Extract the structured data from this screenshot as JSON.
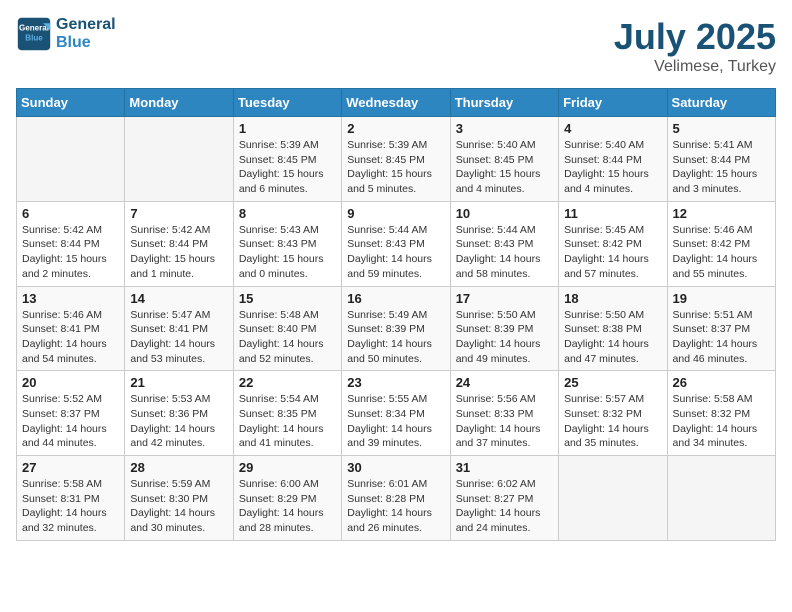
{
  "logo": {
    "line1": "General",
    "line2": "Blue"
  },
  "title": "July 2025",
  "subtitle": "Velimese, Turkey",
  "days_of_week": [
    "Sunday",
    "Monday",
    "Tuesday",
    "Wednesday",
    "Thursday",
    "Friday",
    "Saturday"
  ],
  "weeks": [
    [
      {
        "day": "",
        "info": ""
      },
      {
        "day": "",
        "info": ""
      },
      {
        "day": "1",
        "info": "Sunrise: 5:39 AM\nSunset: 8:45 PM\nDaylight: 15 hours\nand 6 minutes."
      },
      {
        "day": "2",
        "info": "Sunrise: 5:39 AM\nSunset: 8:45 PM\nDaylight: 15 hours\nand 5 minutes."
      },
      {
        "day": "3",
        "info": "Sunrise: 5:40 AM\nSunset: 8:45 PM\nDaylight: 15 hours\nand 4 minutes."
      },
      {
        "day": "4",
        "info": "Sunrise: 5:40 AM\nSunset: 8:44 PM\nDaylight: 15 hours\nand 4 minutes."
      },
      {
        "day": "5",
        "info": "Sunrise: 5:41 AM\nSunset: 8:44 PM\nDaylight: 15 hours\nand 3 minutes."
      }
    ],
    [
      {
        "day": "6",
        "info": "Sunrise: 5:42 AM\nSunset: 8:44 PM\nDaylight: 15 hours\nand 2 minutes."
      },
      {
        "day": "7",
        "info": "Sunrise: 5:42 AM\nSunset: 8:44 PM\nDaylight: 15 hours\nand 1 minute."
      },
      {
        "day": "8",
        "info": "Sunrise: 5:43 AM\nSunset: 8:43 PM\nDaylight: 15 hours\nand 0 minutes."
      },
      {
        "day": "9",
        "info": "Sunrise: 5:44 AM\nSunset: 8:43 PM\nDaylight: 14 hours\nand 59 minutes."
      },
      {
        "day": "10",
        "info": "Sunrise: 5:44 AM\nSunset: 8:43 PM\nDaylight: 14 hours\nand 58 minutes."
      },
      {
        "day": "11",
        "info": "Sunrise: 5:45 AM\nSunset: 8:42 PM\nDaylight: 14 hours\nand 57 minutes."
      },
      {
        "day": "12",
        "info": "Sunrise: 5:46 AM\nSunset: 8:42 PM\nDaylight: 14 hours\nand 55 minutes."
      }
    ],
    [
      {
        "day": "13",
        "info": "Sunrise: 5:46 AM\nSunset: 8:41 PM\nDaylight: 14 hours\nand 54 minutes."
      },
      {
        "day": "14",
        "info": "Sunrise: 5:47 AM\nSunset: 8:41 PM\nDaylight: 14 hours\nand 53 minutes."
      },
      {
        "day": "15",
        "info": "Sunrise: 5:48 AM\nSunset: 8:40 PM\nDaylight: 14 hours\nand 52 minutes."
      },
      {
        "day": "16",
        "info": "Sunrise: 5:49 AM\nSunset: 8:39 PM\nDaylight: 14 hours\nand 50 minutes."
      },
      {
        "day": "17",
        "info": "Sunrise: 5:50 AM\nSunset: 8:39 PM\nDaylight: 14 hours\nand 49 minutes."
      },
      {
        "day": "18",
        "info": "Sunrise: 5:50 AM\nSunset: 8:38 PM\nDaylight: 14 hours\nand 47 minutes."
      },
      {
        "day": "19",
        "info": "Sunrise: 5:51 AM\nSunset: 8:37 PM\nDaylight: 14 hours\nand 46 minutes."
      }
    ],
    [
      {
        "day": "20",
        "info": "Sunrise: 5:52 AM\nSunset: 8:37 PM\nDaylight: 14 hours\nand 44 minutes."
      },
      {
        "day": "21",
        "info": "Sunrise: 5:53 AM\nSunset: 8:36 PM\nDaylight: 14 hours\nand 42 minutes."
      },
      {
        "day": "22",
        "info": "Sunrise: 5:54 AM\nSunset: 8:35 PM\nDaylight: 14 hours\nand 41 minutes."
      },
      {
        "day": "23",
        "info": "Sunrise: 5:55 AM\nSunset: 8:34 PM\nDaylight: 14 hours\nand 39 minutes."
      },
      {
        "day": "24",
        "info": "Sunrise: 5:56 AM\nSunset: 8:33 PM\nDaylight: 14 hours\nand 37 minutes."
      },
      {
        "day": "25",
        "info": "Sunrise: 5:57 AM\nSunset: 8:32 PM\nDaylight: 14 hours\nand 35 minutes."
      },
      {
        "day": "26",
        "info": "Sunrise: 5:58 AM\nSunset: 8:32 PM\nDaylight: 14 hours\nand 34 minutes."
      }
    ],
    [
      {
        "day": "27",
        "info": "Sunrise: 5:58 AM\nSunset: 8:31 PM\nDaylight: 14 hours\nand 32 minutes."
      },
      {
        "day": "28",
        "info": "Sunrise: 5:59 AM\nSunset: 8:30 PM\nDaylight: 14 hours\nand 30 minutes."
      },
      {
        "day": "29",
        "info": "Sunrise: 6:00 AM\nSunset: 8:29 PM\nDaylight: 14 hours\nand 28 minutes."
      },
      {
        "day": "30",
        "info": "Sunrise: 6:01 AM\nSunset: 8:28 PM\nDaylight: 14 hours\nand 26 minutes."
      },
      {
        "day": "31",
        "info": "Sunrise: 6:02 AM\nSunset: 8:27 PM\nDaylight: 14 hours\nand 24 minutes."
      },
      {
        "day": "",
        "info": ""
      },
      {
        "day": "",
        "info": ""
      }
    ]
  ]
}
